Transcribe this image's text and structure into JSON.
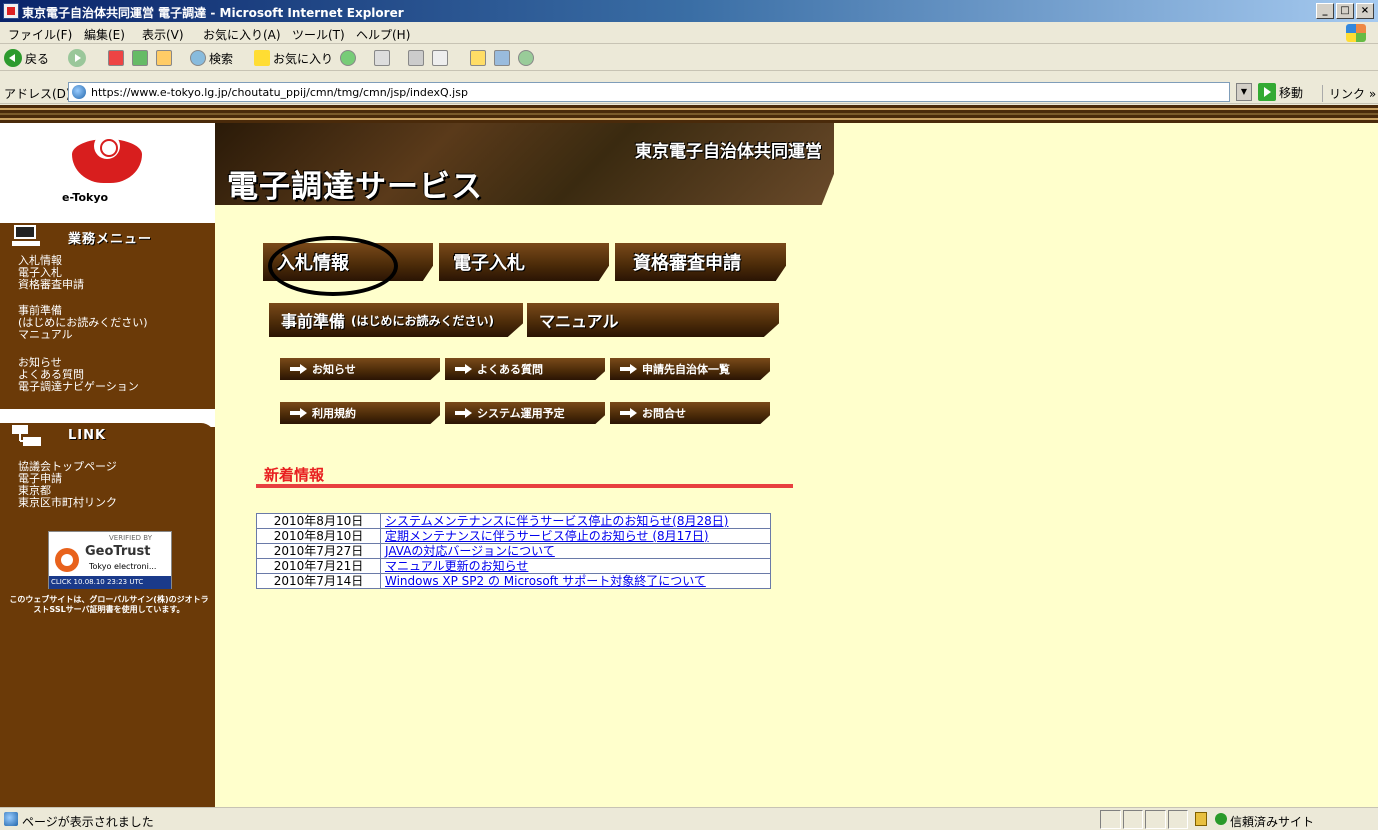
{
  "window": {
    "title": "東京電子自治体共同運営 電子調達 - Microsoft Internet Explorer",
    "minimize": "_",
    "maximize": "□",
    "close": "×"
  },
  "menu": [
    "ファイル(F)",
    "編集(E)",
    "表示(V)",
    "お気に入り(A)",
    "ツール(T)",
    "ヘルプ(H)"
  ],
  "toolbar": {
    "back": "戻る",
    "search": "検索",
    "favorites": "お気に入り"
  },
  "address": {
    "label": "アドレス(D)",
    "url": "https://www.e-tokyo.lg.jp/choutatu_ppij/cmn/tmg/cmn/jsp/indexQ.jsp",
    "dropdown": "▼",
    "go": "移動",
    "links": "リンク »"
  },
  "logo": {
    "text": "e-Tokyo"
  },
  "sidebar": {
    "menu_title": "業務メニュー",
    "menu_links": [
      [
        "入札情報",
        "電子入札",
        "資格審査申請"
      ],
      [
        "事前準備",
        "(はじめにお読みください)",
        "マニュアル"
      ],
      [
        "お知らせ",
        "よくある質問",
        "電子調達ナビゲーション"
      ]
    ],
    "link_title": "LINK",
    "external_links": [
      "協議会トップページ",
      "電子申請",
      "東京都",
      "東京区市町村リンク"
    ],
    "geotrust": {
      "verified": "VERIFIED BY",
      "brand": "GeoTrust",
      "sub": "Tokyo electroni...",
      "click": "CLICK 10.08.10 23:23 UTC"
    },
    "geotrust_note": "このウェブサイトは、グローバルサイン(株)のジオトラストSSLサーバ証明書を使用しています。"
  },
  "banner": {
    "org": "東京電子自治体共同運営",
    "service": "電子調達サービス"
  },
  "main_buttons": {
    "bid_info": "入札情報",
    "e_bid": "電子入札",
    "qualification": "資格審査申請",
    "preparation": "事前準備",
    "preparation_note": "(はじめにお読みください)",
    "manual": "マニュアル"
  },
  "sub_buttons": [
    "お知らせ",
    "よくある質問",
    "申請先自治体一覧",
    "利用規約",
    "システム運用予定",
    "お問合せ"
  ],
  "news": {
    "title": "新着情報",
    "items": [
      {
        "date": "2010年8月10日",
        "title": "システムメンテナンスに伴うサービス停止のお知らせ(8月28日)"
      },
      {
        "date": "2010年8月10日",
        "title": "定期メンテナンスに伴うサービス停止のお知らせ (8月17日)"
      },
      {
        "date": "2010年7月27日",
        "title": "JAVAの対応バージョンについて"
      },
      {
        "date": "2010年7月21日",
        "title": "マニュアル更新のお知らせ"
      },
      {
        "date": "2010年7月14日",
        "title": "Windows XP SP2 の Microsoft サポート対象終了について"
      }
    ]
  },
  "status": {
    "text": "ページが表示されました",
    "zone": "信頼済みサイト"
  }
}
